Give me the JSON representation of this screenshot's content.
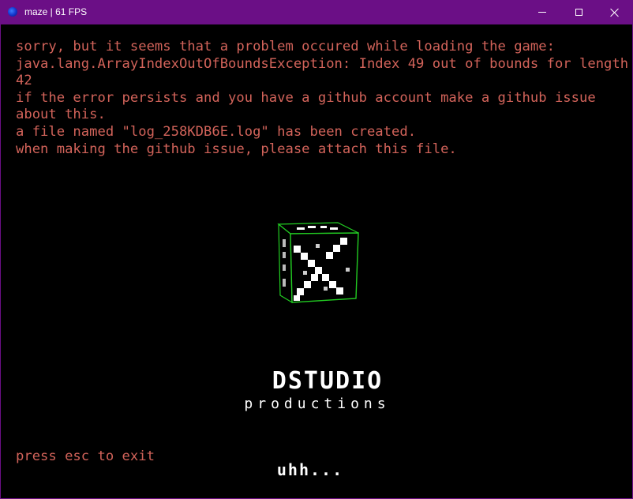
{
  "window": {
    "title": "maze | 61 FPS",
    "app_icon": "app-globe-icon",
    "titlebar_color": "#6b0f86"
  },
  "error": {
    "text_color": "#d2635a",
    "lines": [
      "sorry, but it seems that a problem occured while loading the game:",
      "java.lang.ArrayIndexOutOfBoundsException: Index 49 out of bounds for length",
      "42",
      "if the error persists and you have a github account make a github issue",
      "about this.",
      "a file named \"log_258KDB6E.log\" has been created.",
      "when making the github issue, please attach this file."
    ]
  },
  "exit_hint": "press esc to exit",
  "logo": {
    "brand": "DSTUDIO",
    "subtitle": "productions",
    "outline_color": "#22cc22"
  },
  "status_text": "uhh..."
}
